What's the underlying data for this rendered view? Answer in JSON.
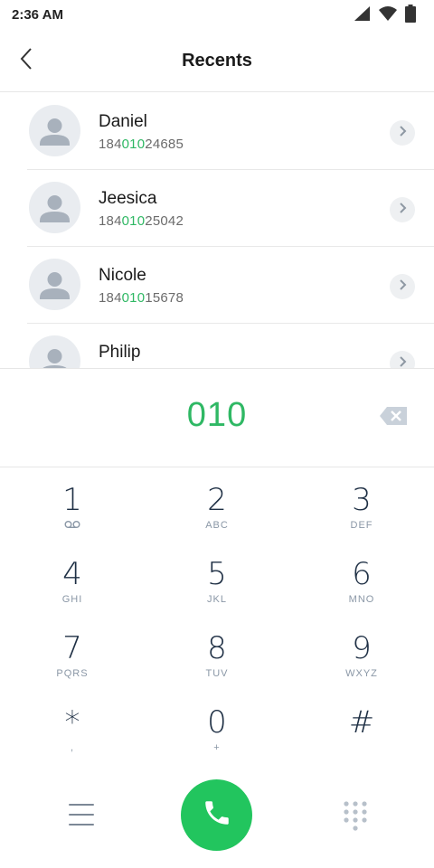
{
  "status_bar": {
    "time": "2:36 AM",
    "icons": [
      "signal-icon",
      "wifi-icon",
      "battery-icon"
    ]
  },
  "header": {
    "title": "Recents",
    "back_icon": "chevron-left-icon"
  },
  "recents": [
    {
      "name": "Daniel",
      "number_prefix": "184",
      "number_match": "010",
      "number_suffix": "24685"
    },
    {
      "name": "Jeesica",
      "number_prefix": "184",
      "number_match": "010",
      "number_suffix": "25042"
    },
    {
      "name": "Nicole",
      "number_prefix": "184",
      "number_match": "010",
      "number_suffix": "15678"
    },
    {
      "name": "Philip",
      "number_prefix": "",
      "number_match": "",
      "number_suffix": ""
    }
  ],
  "dialer": {
    "entered_digits": "010",
    "keys": [
      {
        "num": "1",
        "sub": ""
      },
      {
        "num": "2",
        "sub": "ABC"
      },
      {
        "num": "3",
        "sub": "DEF"
      },
      {
        "num": "4",
        "sub": "GHI"
      },
      {
        "num": "5",
        "sub": "JKL"
      },
      {
        "num": "6",
        "sub": "MNO"
      },
      {
        "num": "7",
        "sub": "PQRS"
      },
      {
        "num": "8",
        "sub": "TUV"
      },
      {
        "num": "9",
        "sub": "WXYZ"
      },
      {
        "num": "*",
        "sub": ","
      },
      {
        "num": "0",
        "sub": "+"
      },
      {
        "num": "#",
        "sub": ""
      }
    ]
  },
  "colors": {
    "accent": "#2fb864",
    "call_button": "#22c55e",
    "key_digit": "#1e2f44",
    "key_letters": "#8a97a6"
  }
}
